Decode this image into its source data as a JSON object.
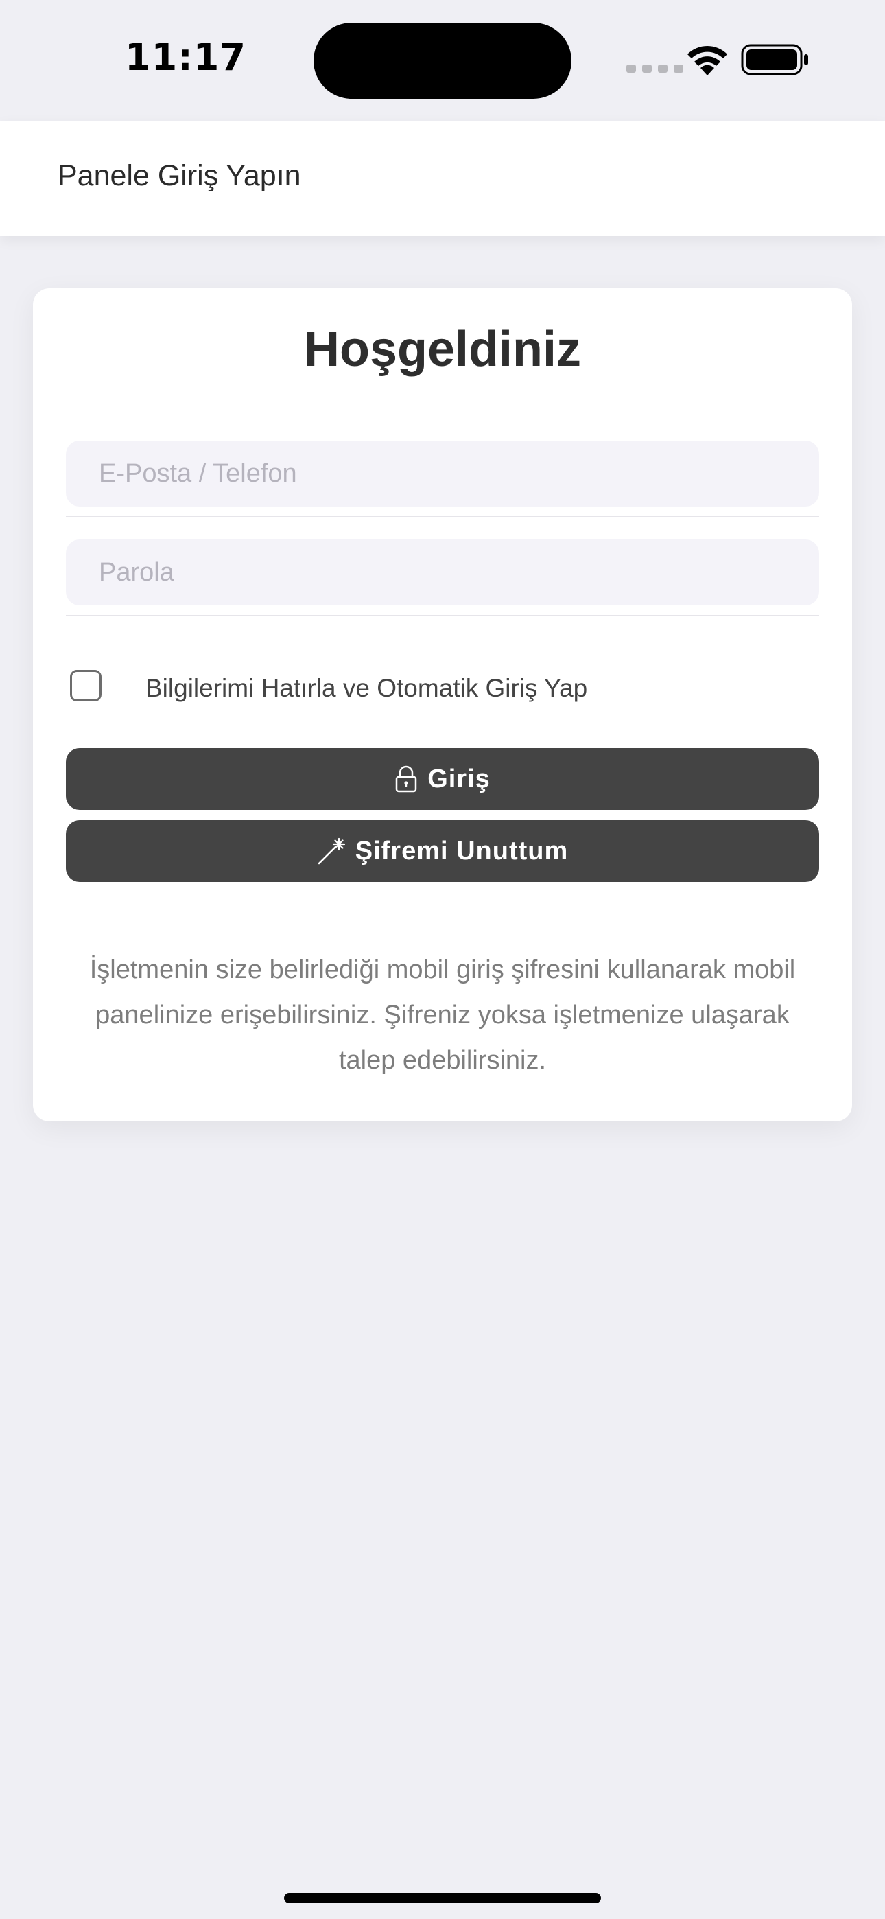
{
  "status_bar": {
    "time": "11:17",
    "icons": [
      "cellular-signal-icon",
      "wifi-icon",
      "battery-icon"
    ]
  },
  "nav": {
    "title": "Panele Giriş Yapın"
  },
  "card": {
    "title": "Hoşgeldiniz",
    "email_field": {
      "placeholder": "E-Posta / Telefon",
      "value": ""
    },
    "password_field": {
      "placeholder": "Parola",
      "value": ""
    },
    "remember": {
      "label": "Bilgilerimi Hatırla ve Otomatik Giriş Yap",
      "checked": false
    },
    "login_button": {
      "label": "Giriş",
      "icon": "lock-icon"
    },
    "forgot_button": {
      "label": "Şifremi Unuttum",
      "icon": "magic-wand-icon"
    },
    "info": "İşletmenin size belirlediği mobil giriş şifresini kullanarak mobil panelinize erişebilirsiniz. Şifreniz yoksa işletmenize ulaşarak talep edebilirsiniz."
  },
  "colors": {
    "background": "#efeff4",
    "card": "#ffffff",
    "button": "#444444",
    "field": "#f4f3f9",
    "info_text": "#7d7d7d"
  }
}
